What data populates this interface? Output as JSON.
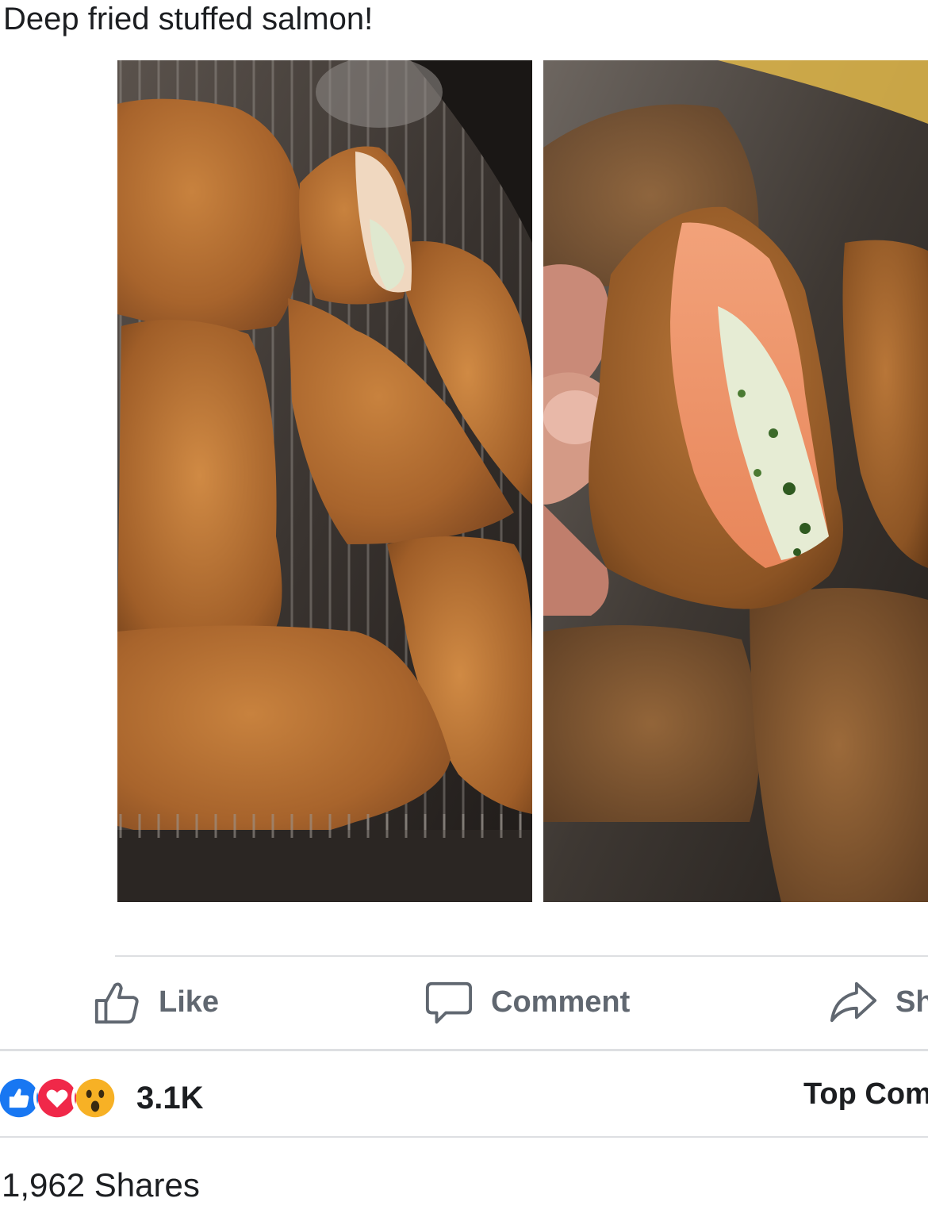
{
  "post": {
    "caption": "Deep fried stuffed salmon!"
  },
  "actions": {
    "like_label": "Like",
    "comment_label": "Comment",
    "share_label": "Sh"
  },
  "reactions": {
    "icons": [
      "like-reaction-icon",
      "love-reaction-icon",
      "wow-reaction-icon"
    ],
    "count": "3.1K",
    "like_color": "#1877f2",
    "love_color": "#f02849",
    "wow_color": "#f7b125"
  },
  "comments": {
    "sort_label": "Top Com"
  },
  "shares": {
    "label": "1,962 Shares"
  }
}
